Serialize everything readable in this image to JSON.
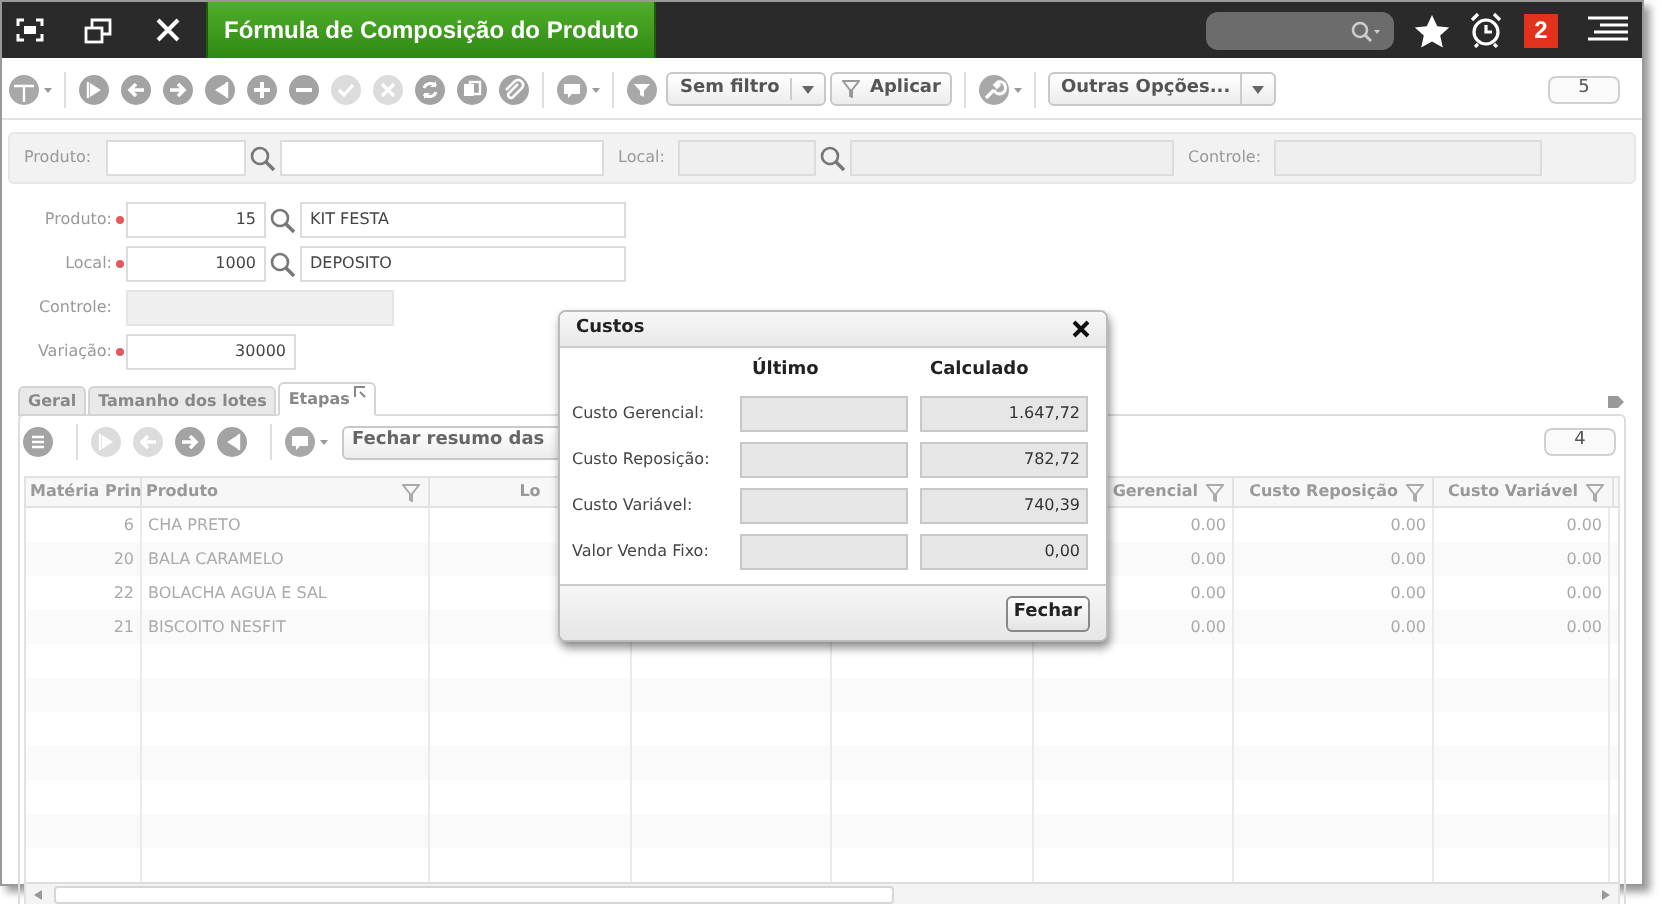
{
  "window": {
    "title": "Fórmula de Composição do Produto",
    "notification_count": "2"
  },
  "toolbar": {
    "buttons": [
      {
        "disabled": false
      },
      {
        "disabled": false
      },
      {
        "disabled": false
      },
      {
        "disabled": false
      },
      {
        "disabled": false
      },
      {
        "disabled": false
      },
      {
        "disabled": true
      },
      {
        "disabled": true
      },
      {
        "disabled": false
      },
      {
        "disabled": false
      },
      {
        "disabled": false
      }
    ],
    "filter": "Sem filtro",
    "apply": "Aplicar",
    "more_options": "Outras Opções...",
    "record_count": "5"
  },
  "filter_bar": {
    "fields": [
      {
        "label": "Produto:",
        "lookup": true,
        "disabled": false
      },
      {
        "label": "Local:",
        "lookup": true,
        "disabled": true
      },
      {
        "label": "Controle:",
        "lookup": false,
        "disabled": true
      }
    ]
  },
  "form": {
    "fields": [
      {
        "label": "Produto:",
        "required": true,
        "code": "15",
        "description": "KIT FESTA",
        "kind": "lookup"
      },
      {
        "label": "Local:",
        "required": true,
        "code": "1000",
        "description": "DEPOSITO",
        "kind": "lookup"
      },
      {
        "label": "Controle:",
        "required": false,
        "kind": "disabled"
      },
      {
        "label": "Variação:",
        "required": true,
        "code": "30000",
        "kind": "number"
      }
    ]
  },
  "tabs": [
    {
      "label": "Geral",
      "selected": false
    },
    {
      "label": "Tamanho dos lotes",
      "selected": false
    },
    {
      "label": "Etapas",
      "selected": true
    }
  ],
  "detail_toolbar": {
    "buttons": [
      {
        "disabled": false
      },
      {
        "disabled": true
      },
      {
        "disabled": true
      },
      {
        "disabled": false
      },
      {
        "disabled": false
      }
    ],
    "summary_button": "Fechar resumo das",
    "record_count": "4"
  },
  "table": {
    "columns": [
      {
        "label": "Matéria Prin"
      },
      {
        "label": "Produto",
        "filter": true
      },
      {
        "label": "Lo",
        "filter": false
      },
      {},
      {},
      {
        "label": "Gerencial",
        "filter": true
      },
      {
        "label": "Custo Reposição",
        "filter": true
      },
      {
        "label": "Custo Variável",
        "filter": true
      }
    ],
    "rows": [
      {
        "cells": [
          "6",
          "CHA PRETO",
          null,
          null,
          null,
          "0.00",
          "0.00",
          "0.00"
        ]
      },
      {
        "cells": [
          "20",
          "BALA CARAMELO",
          null,
          null,
          null,
          "0.00",
          "0.00",
          "0.00"
        ]
      },
      {
        "cells": [
          "22",
          "BOLACHA AGUA E SAL",
          null,
          null,
          null,
          "0.00",
          "0.00",
          "0.00"
        ]
      },
      {
        "cells": [
          "21",
          "BISCOITO NESFIT",
          null,
          null,
          null,
          "0.00",
          "0.00",
          "0.00"
        ]
      }
    ]
  },
  "dialog": {
    "title": "Custos",
    "columns": [
      "Último",
      "Calculado"
    ],
    "rows": [
      {
        "label": "Custo Gerencial:",
        "calculado": "1.647,72"
      },
      {
        "label": "Custo Reposição:",
        "calculado": "782,72"
      },
      {
        "label": "Custo Variável:",
        "calculado": "740,39"
      },
      {
        "label": "Valor Venda Fixo:",
        "calculado": "0,00"
      }
    ],
    "close_button": "Fechar"
  }
}
